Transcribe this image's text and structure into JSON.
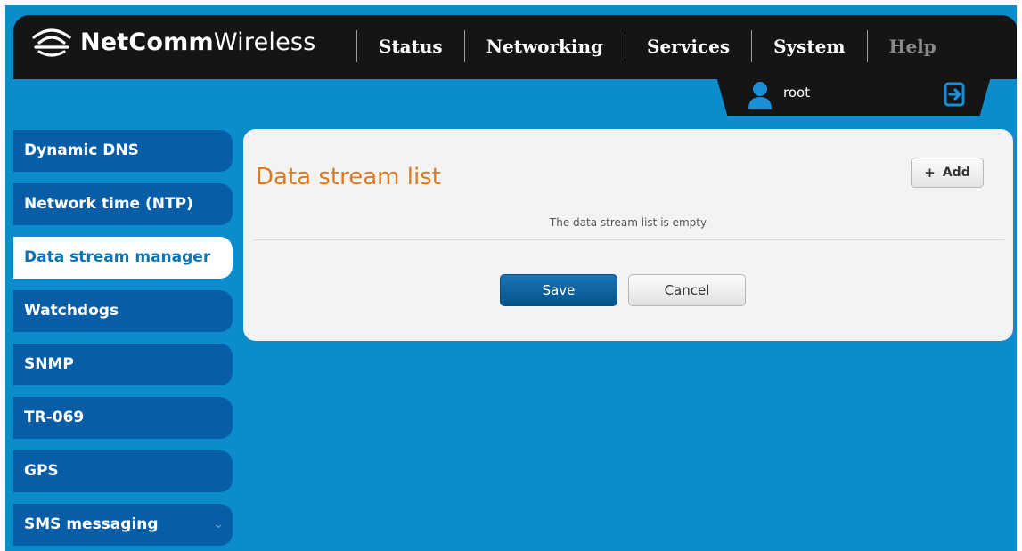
{
  "brand": {
    "name_bold": "NetComm",
    "name_light": "Wireless",
    "icon": "wifi-logo-icon"
  },
  "nav": {
    "items": [
      {
        "label": "Status",
        "enabled": true
      },
      {
        "label": "Networking",
        "enabled": true
      },
      {
        "label": "Services",
        "enabled": true
      },
      {
        "label": "System",
        "enabled": true
      },
      {
        "label": "Help",
        "enabled": false
      }
    ]
  },
  "user": {
    "name": "root",
    "icon": "user-icon",
    "logout_icon": "logout-icon"
  },
  "sidebar": {
    "items": [
      {
        "label": "Dynamic DNS",
        "active": false
      },
      {
        "label": "Network time (NTP)",
        "active": false
      },
      {
        "label": "Data stream manager",
        "active": true
      },
      {
        "label": "Watchdogs",
        "active": false
      },
      {
        "label": "SNMP",
        "active": false
      },
      {
        "label": "TR-069",
        "active": false
      },
      {
        "label": "GPS",
        "active": false
      },
      {
        "label": "SMS messaging",
        "active": false,
        "expandable": true
      }
    ]
  },
  "main": {
    "title": "Data stream list",
    "add_label": "Add",
    "empty_message": "The data stream list is empty",
    "save_label": "Save",
    "cancel_label": "Cancel"
  },
  "colors": {
    "background": "#0a8ccd",
    "header": "#151515",
    "sidebar_item": "#075ea6",
    "title": "#e07a1f",
    "primary_button": "#05528a"
  }
}
